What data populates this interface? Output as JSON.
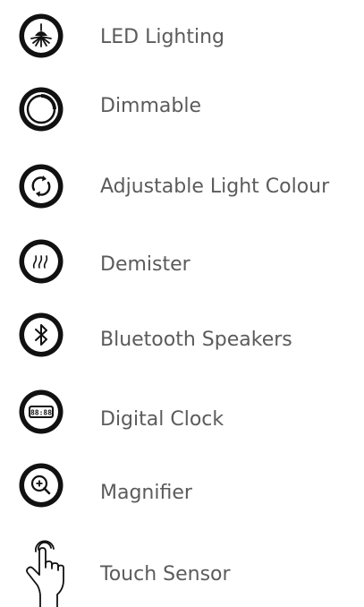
{
  "features": [
    {
      "label": "LED Lighting",
      "icon": "led-lighting-icon"
    },
    {
      "label": "Dimmable",
      "icon": "dimmable-icon"
    },
    {
      "label": "Adjustable Light Colour",
      "icon": "adjustable-light-colour-icon"
    },
    {
      "label": "Demister",
      "icon": "demister-icon"
    },
    {
      "label": "Bluetooth Speakers",
      "icon": "bluetooth-icon"
    },
    {
      "label": "Digital Clock",
      "icon": "digital-clock-icon"
    },
    {
      "label": "Magnifier",
      "icon": "magnifier-icon"
    },
    {
      "label": "Touch Sensor",
      "icon": "touch-hand-icon"
    }
  ],
  "colors": {
    "icon": "#111111",
    "text": "#5b5b5b"
  }
}
